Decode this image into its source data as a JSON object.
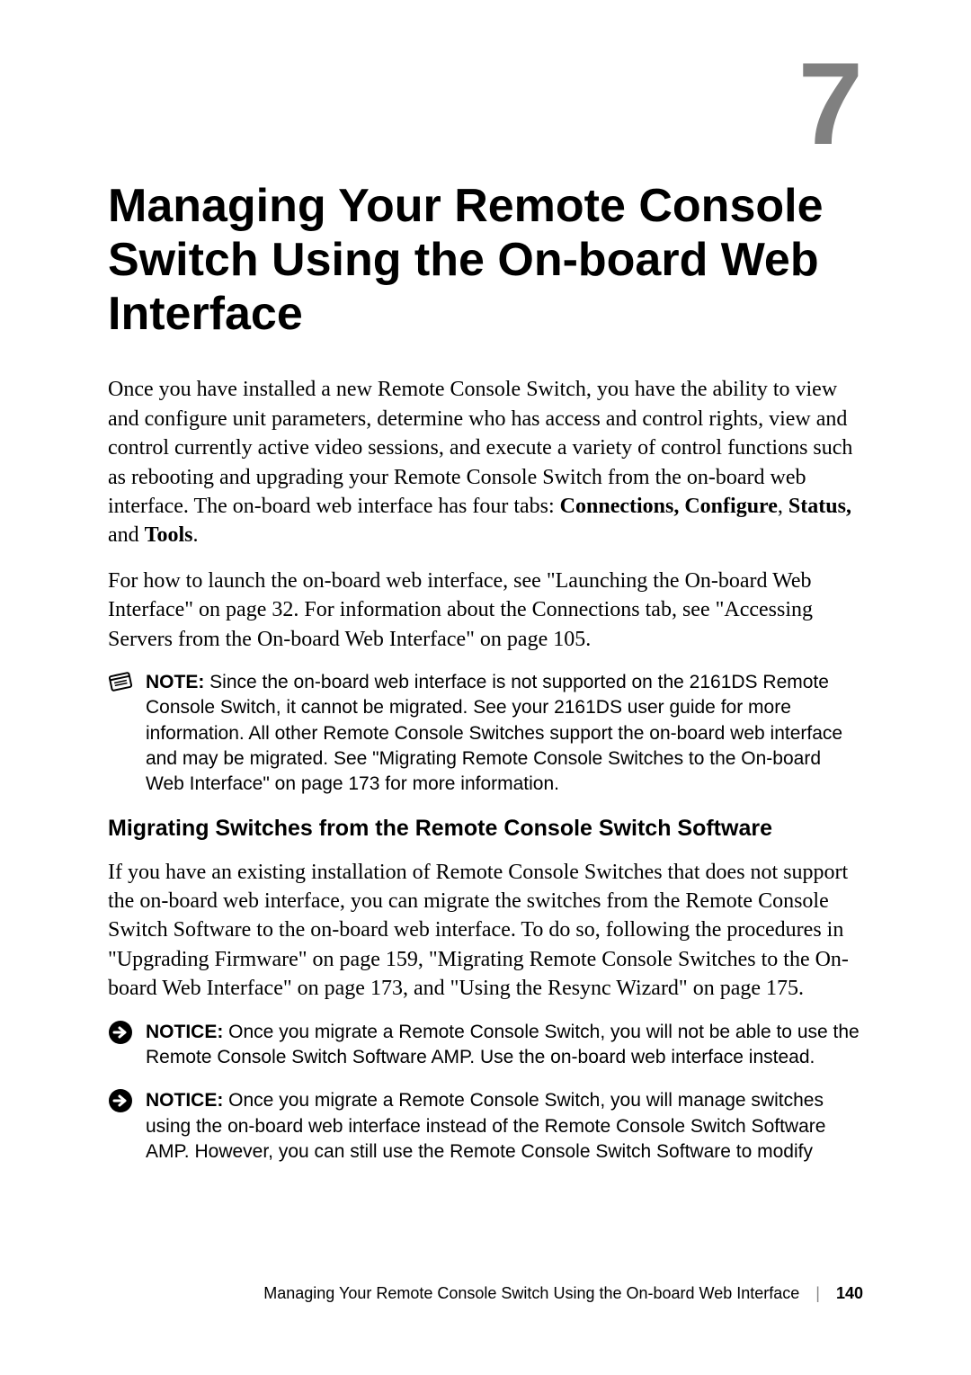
{
  "chapter": {
    "number": "7",
    "title": "Managing Your Remote Console Switch Using the On-board Web Interface"
  },
  "paragraphs": {
    "p1_pre": "Once you have installed a new Remote Console Switch, you have the ability to view and configure unit parameters, determine who has access and control rights, view and control currently active video sessions, and execute a variety of control functions such as rebooting and upgrading your Remote Console Switch from the on-board web interface. The on-board web interface has four tabs: ",
    "p1_b1": "Connections, Configure",
    "p1_mid1": ", ",
    "p1_b2": "Status,",
    "p1_mid2": " and ",
    "p1_b3": "Tools",
    "p1_post": ".",
    "p2": "For how to launch the on-board web interface, see \"Launching the On-board Web Interface\" on page 32. For information about the Connections tab, see \"Accessing Servers from the On-board Web Interface\" on page 105.",
    "p3": "If you have an existing installation of Remote Console Switches that does not support the on-board web interface, you can migrate the switches from the Remote Console Switch Software to the on-board web interface. To do so, following the procedures in \"Upgrading Firmware\" on page 159, \"Migrating Remote Console Switches to the On-board Web Interface\" on page 173, and \"Using the Resync Wizard\" on page 175."
  },
  "section_heading": "Migrating Switches from the Remote Console Switch Software",
  "notes": {
    "note1_label": "NOTE:",
    "note1_text": " Since the on-board web interface is not supported on the 2161DS Remote Console Switch, it cannot be migrated. See your 2161DS user guide for more information. All other Remote Console Switches support the on-board web interface and may be migrated. See \"Migrating Remote Console Switches to the On-board Web Interface\" on page 173 for more information.",
    "notice1_label": "NOTICE:",
    "notice1_text": " Once you migrate a Remote Console Switch, you will not be able to use the Remote Console Switch Software AMP. Use the on-board web interface instead.",
    "notice2_label": "NOTICE:",
    "notice2_text": " Once you migrate a Remote Console Switch, you will manage switches using the on-board web interface instead of the Remote Console Switch Software AMP. However, you can still use the Remote Console Switch Software to modify"
  },
  "footer": {
    "title": "Managing Your Remote Console Switch Using the On-board Web Interface",
    "page": "140"
  }
}
